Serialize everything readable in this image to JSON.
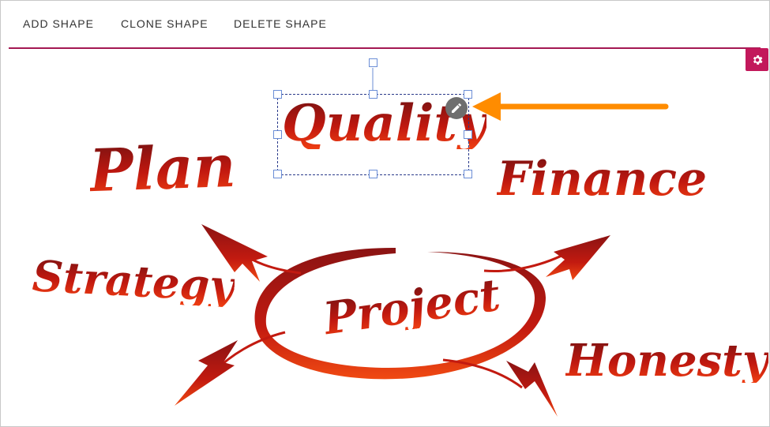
{
  "toolbar": {
    "add": "ADD SHAPE",
    "clone": "CLONE SHAPE",
    "delete": "DELETE SHAPE"
  },
  "icons": {
    "settings": "gear-icon",
    "edit": "pencil-icon",
    "arrow": "orange-arrow"
  },
  "canvas": {
    "words": {
      "quality": "Quality",
      "plan": "Plan",
      "finance": "Finance",
      "strategy": "Strategy",
      "project": "Project",
      "honesty": "Honesty"
    }
  },
  "colors": {
    "accent": "#c2185b",
    "divider": "#a41852",
    "arrow": "#ff8c00",
    "text_red": "#d01e0e"
  }
}
